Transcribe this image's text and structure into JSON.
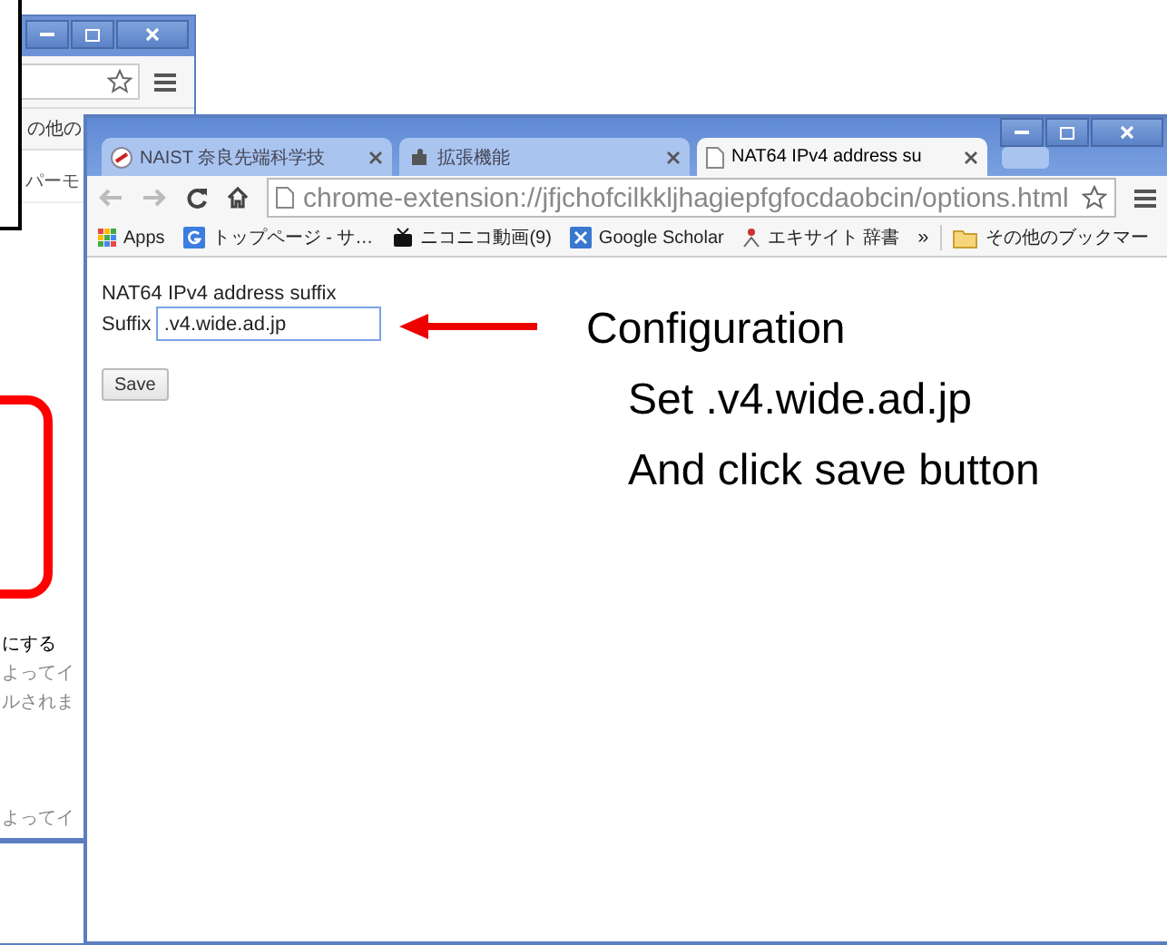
{
  "background_window": {
    "bookmark_text": "の他の",
    "toolbar_text": "パーモ",
    "texts": [
      {
        "text": "にする",
        "dim": false
      },
      {
        "text": "よってイ",
        "dim": true
      },
      {
        "text": "ルされま",
        "dim": true
      },
      {
        "text": "よってイ",
        "dim": true
      }
    ]
  },
  "window": {
    "tabs": [
      {
        "label": "NAIST 奈良先端科学技",
        "selected": false,
        "kind": "site"
      },
      {
        "label": "拡張機能",
        "selected": false,
        "kind": "puzzle"
      },
      {
        "label": "NAT64 IPv4 address su",
        "selected": true,
        "kind": "page"
      }
    ],
    "url": "chrome-extension://jfjchofcilkkljhagiepfgfocdaobcin/options.html",
    "bookmarks": [
      {
        "label": "Apps",
        "kind": "apps"
      },
      {
        "label": "トップページ - サ…",
        "kind": "google"
      },
      {
        "label": "ニコニコ動画(9)",
        "kind": "tv"
      },
      {
        "label": "Google Scholar",
        "kind": "scholar"
      },
      {
        "label": "エキサイト 辞書",
        "kind": "dict"
      },
      {
        "label": "»",
        "kind": "more"
      },
      {
        "label": "その他のブックマー",
        "kind": "folder"
      }
    ],
    "heading": "NAT64 IPv4 address suffix",
    "field": {
      "label": "Suffix",
      "value": ".v4.wide.ad.jp"
    },
    "button": "Save"
  },
  "annotation": {
    "title": "Configuration",
    "lines": [
      "Set .v4.wide.ad.jp",
      "And click save button"
    ]
  }
}
